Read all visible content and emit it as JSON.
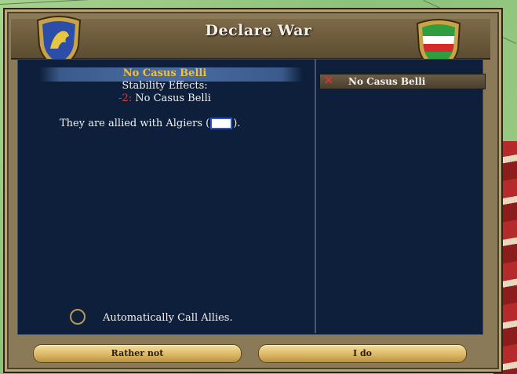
{
  "dialog": {
    "title": "Declare War"
  },
  "casus_belli": {
    "title": "No Casus Belli",
    "stability_label": "Stability Effects:",
    "stability_value": "-2:",
    "stability_reason": "No Casus Belli"
  },
  "alliance": {
    "prefix": "They are allied with Algiers (",
    "suffix": ")."
  },
  "cb_list": [
    {
      "label": "No Casus Belli",
      "icon": "x-icon"
    }
  ],
  "options": {
    "call_allies_label": "Automatically Call Allies."
  },
  "buttons": {
    "decline": "Rather not",
    "confirm": "I do"
  },
  "colors": {
    "panel": "#0d1f3a",
    "gold_text": "#f2c038",
    "negative": "#e33a3a"
  }
}
